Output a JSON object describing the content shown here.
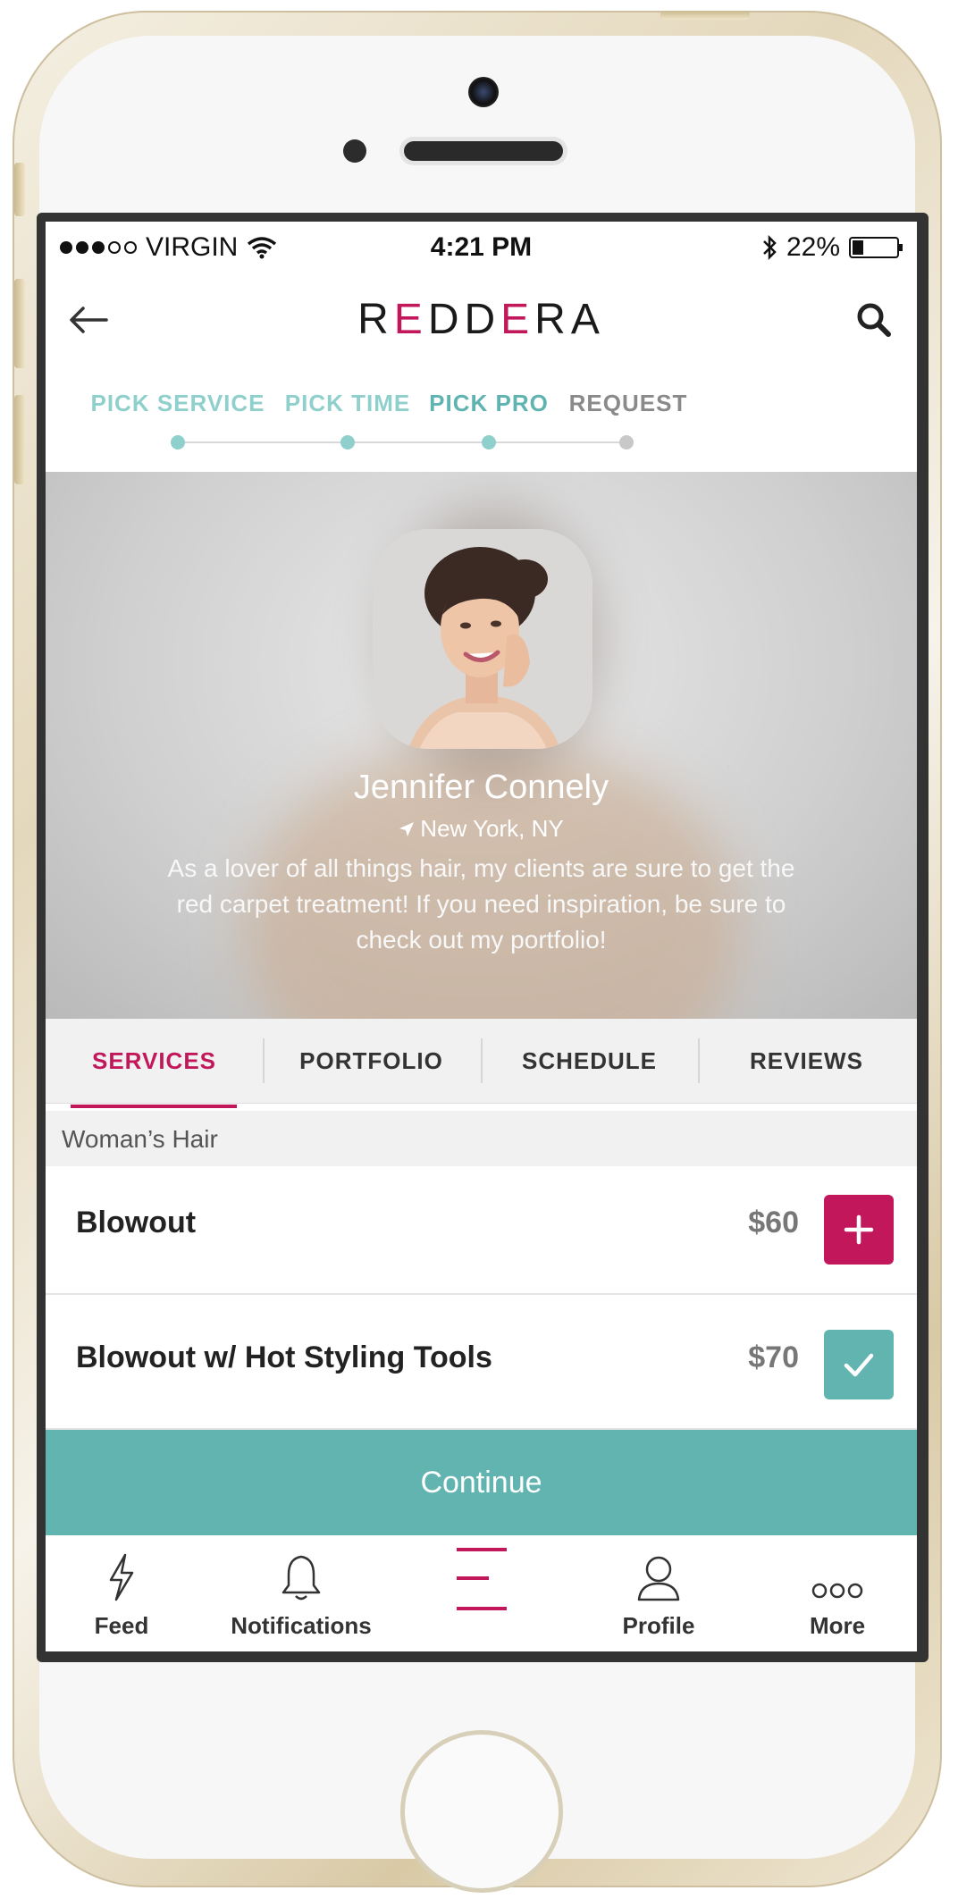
{
  "status_bar": {
    "carrier": "VIRGIN",
    "time": "4:21 PM",
    "battery": "22%",
    "battery_level": 0.22
  },
  "app": {
    "brand": "REDDERA"
  },
  "steps": [
    {
      "label": "PICK SERVICE",
      "color": "#8fcfcc"
    },
    {
      "label": "PICK TIME",
      "color": "#8fcfcc"
    },
    {
      "label": "PICK PRO",
      "color": "#5fb3b0"
    },
    {
      "label": "REQUEST",
      "color": "#8a8a8a"
    }
  ],
  "profile": {
    "name": "Jennifer Connely",
    "location": "New York, NY",
    "bio": "As a lover of all things hair, my clients are sure to get the red carpet treatment! If you need inspiration, be sure to check out my portfolio!"
  },
  "tabs": [
    {
      "label": "SERVICES",
      "active": true
    },
    {
      "label": "PORTFOLIO"
    },
    {
      "label": "SCHEDULE"
    },
    {
      "label": "REVIEWS"
    }
  ],
  "section_title": "Woman’s Hair",
  "services": [
    {
      "name": "Blowout",
      "price": "$60",
      "state": "add",
      "icon": "plus-icon"
    },
    {
      "name": "Blowout w/ Hot Styling Tools",
      "price": "$70",
      "state": "selected",
      "icon": "check-icon"
    }
  ],
  "continue_label": "Continue",
  "bottom_nav": [
    {
      "label": "Feed",
      "icon": "lightning-icon"
    },
    {
      "label": "Notifications",
      "icon": "bell-icon"
    },
    {
      "label": "",
      "icon": "menu-icon"
    },
    {
      "label": "Profile",
      "icon": "user-icon"
    },
    {
      "label": "More",
      "icon": "more-icon"
    }
  ],
  "colors": {
    "brand": "#c2185b",
    "teal": "#62b4b1",
    "teal_light": "#8fcfcc"
  }
}
